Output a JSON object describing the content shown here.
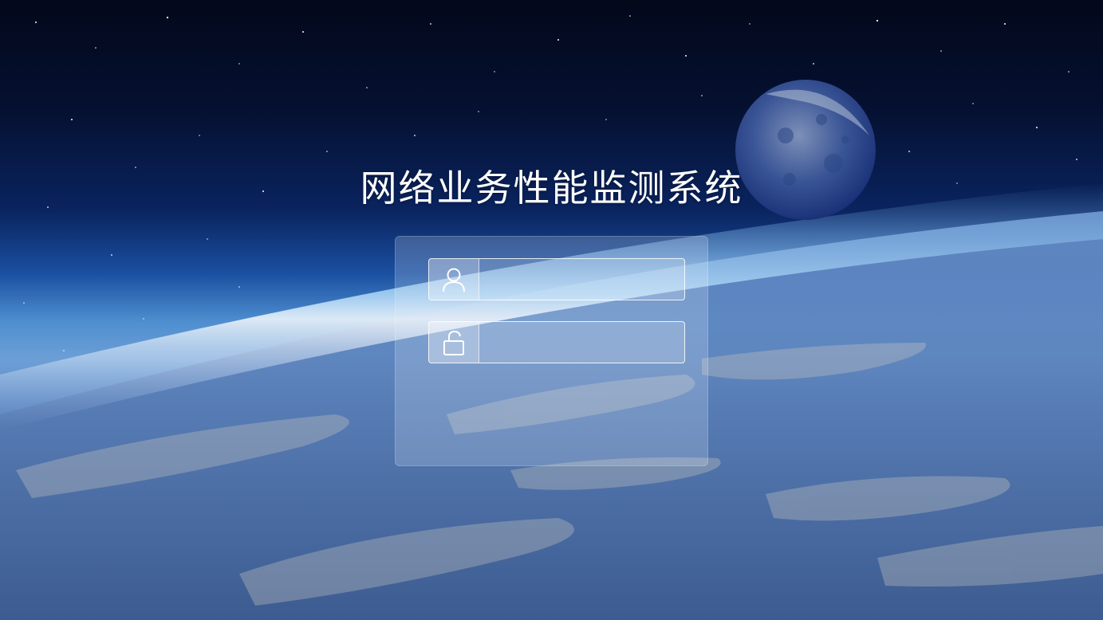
{
  "app": {
    "title": "网络业务性能监测系统"
  },
  "login": {
    "username": {
      "icon": "user-icon",
      "value": "",
      "placeholder": ""
    },
    "password": {
      "icon": "lock-icon",
      "value": "",
      "placeholder": ""
    }
  },
  "colors": {
    "title_text": "#ffffff",
    "panel": "#dbe6f7",
    "field_border": "#ffffff"
  }
}
